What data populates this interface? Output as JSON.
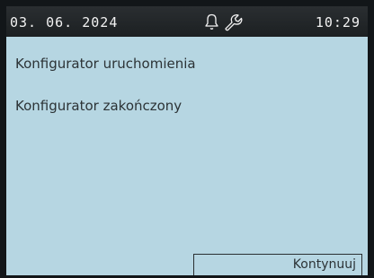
{
  "status_bar": {
    "date": "03. 06. 2024",
    "time": "10:29",
    "icons": [
      "bell-icon",
      "wrench-icon"
    ]
  },
  "wizard": {
    "title": "Konfigurator uruchomienia",
    "message": "Konfigurator zakończony"
  },
  "actions": {
    "continue_label": "Kontynuuj"
  },
  "colors": {
    "screen_background": "#b6d6e2",
    "status_bar_background": "#1c2022",
    "text": "#2c3336"
  }
}
